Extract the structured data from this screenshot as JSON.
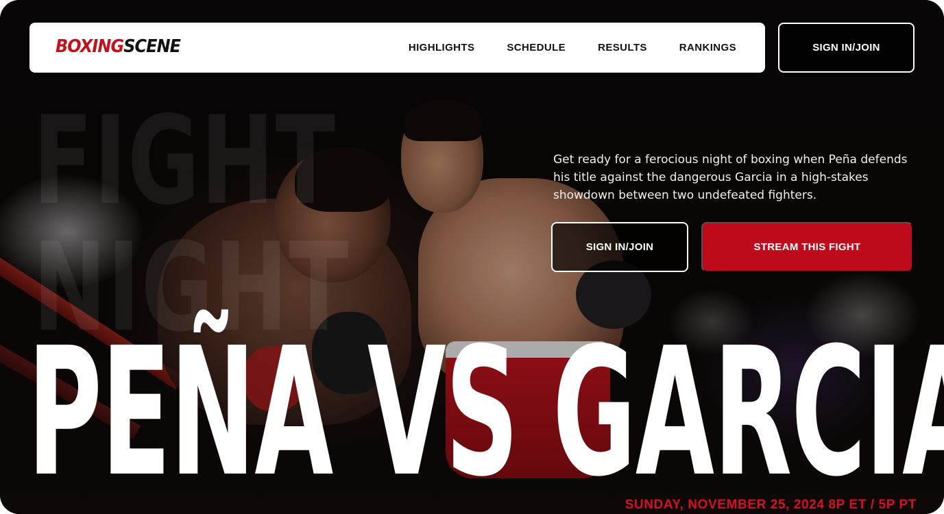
{
  "brand": {
    "logo_part1": "BOXING",
    "logo_part2": "SCENE",
    "accent_color": "#be0b1c"
  },
  "nav": {
    "items": [
      {
        "label": "HIGHLIGHTS"
      },
      {
        "label": "SCHEDULE"
      },
      {
        "label": "RESULTS"
      },
      {
        "label": "RANKINGS"
      }
    ],
    "signin_label": "SIGN IN/JOIN"
  },
  "hero": {
    "ghost_text": "FIGHT\nNIGHT",
    "description": "Get ready for a ferocious night of boxing when Peña defends his title against the dangerous Garcia in a high-stakes showdown between two undefeated fighters.",
    "signin_label": "SIGN IN/JOIN",
    "stream_label": "STREAM THIS FIGHT",
    "headline": "PEÑA VS GARCIA",
    "date": "SUNDAY, NOVEMBER 25, 2024 8P ET / 5P PT"
  }
}
